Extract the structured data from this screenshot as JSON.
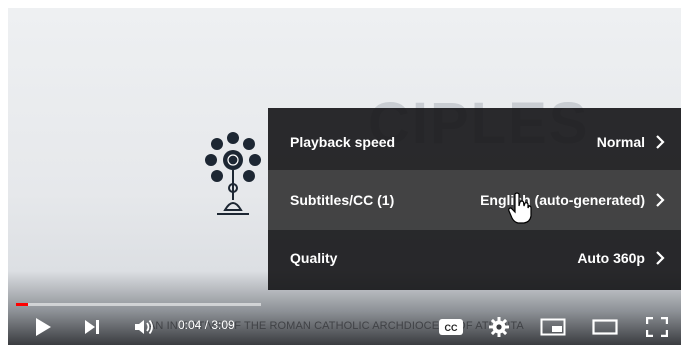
{
  "video": {
    "background_title": "CIPLES",
    "caption_text": "AN INITIATIVE OF THE ROMAN CATHOLIC ARCHDIOCESE OF ATLANTA",
    "progress_fraction": 0.05
  },
  "settings_menu": {
    "items": [
      {
        "label": "Playback speed",
        "value": "Normal"
      },
      {
        "label": "Subtitles/CC (1)",
        "value": "English (auto-generated)"
      },
      {
        "label": "Quality",
        "value": "Auto 360p"
      }
    ]
  },
  "controls": {
    "time_display": "0:04 / 3:09",
    "cc_label": "CC"
  },
  "colors": {
    "progress": "#ff0000",
    "menu_bg": "#141416",
    "text": "#ffffff"
  },
  "icons": [
    "play-icon",
    "next-icon",
    "volume-icon",
    "cc-icon",
    "settings-gear-icon",
    "miniplayer-icon",
    "theater-mode-icon",
    "fullscreen-icon",
    "chevron-right-icon",
    "hand-cursor-icon"
  ]
}
